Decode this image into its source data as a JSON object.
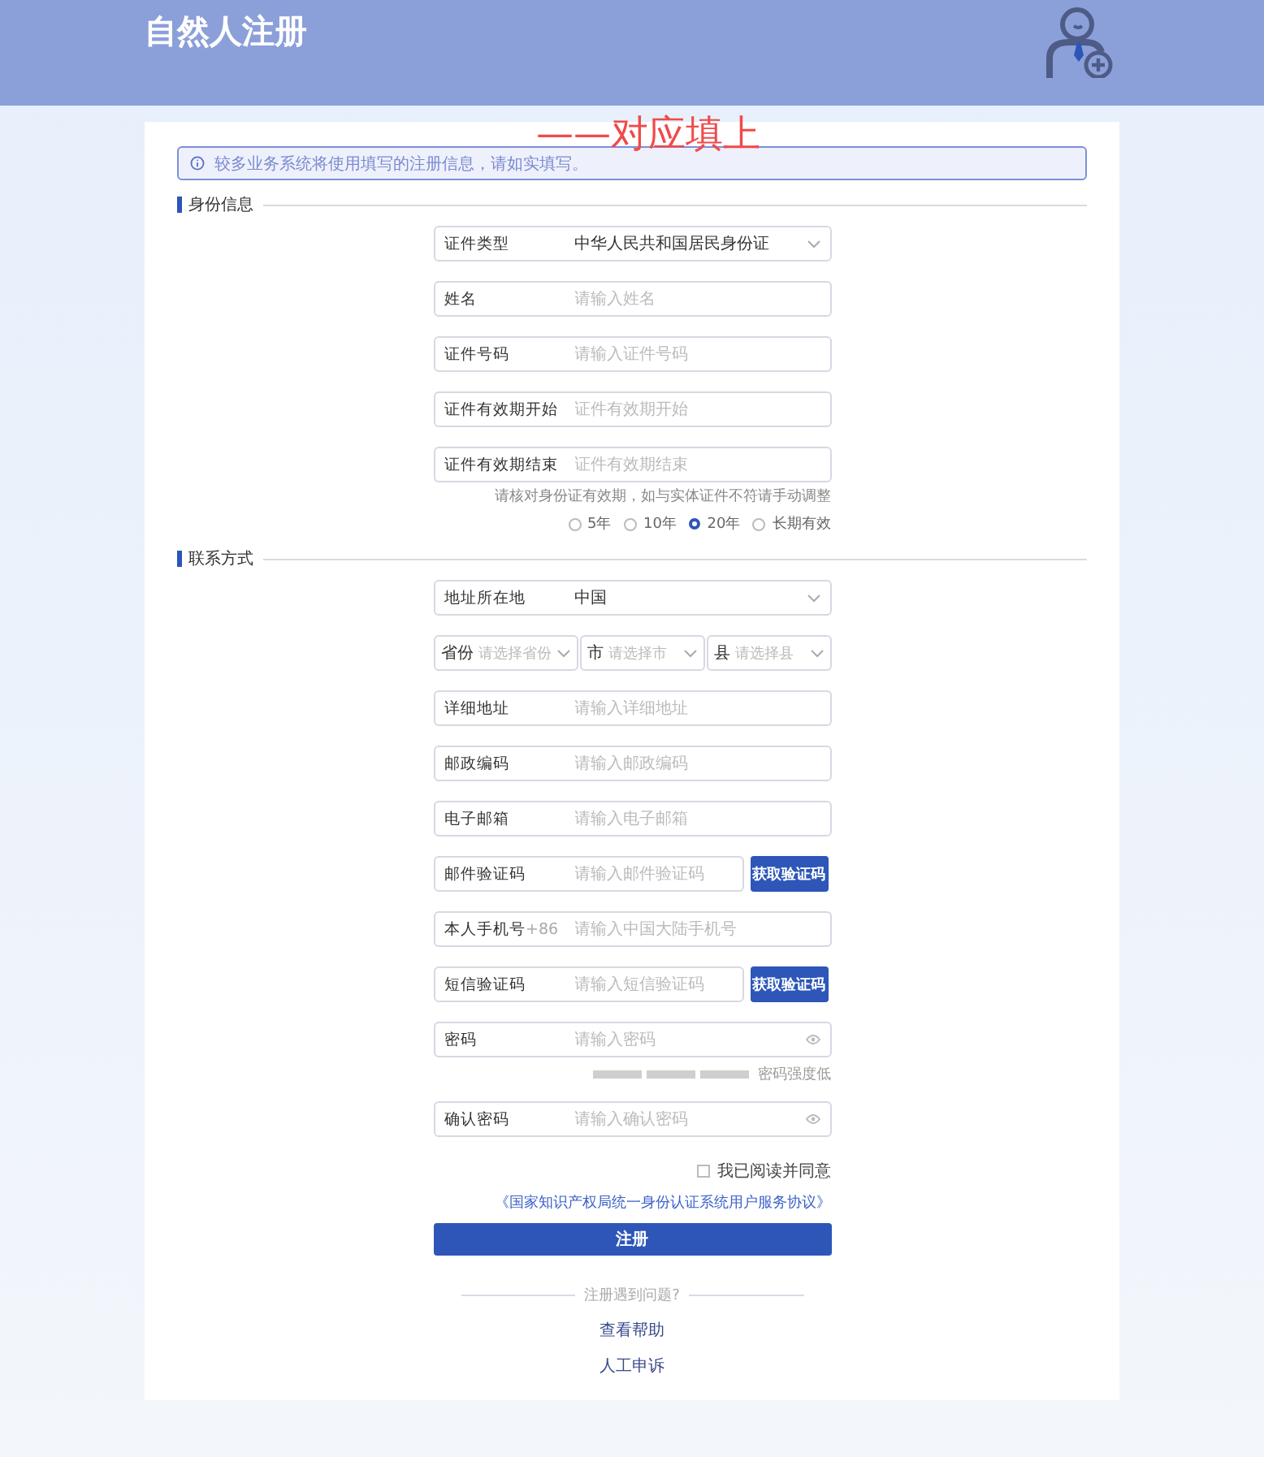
{
  "header": {
    "title": "自然人注册"
  },
  "annotation": "——对应填上",
  "notice": "较多业务系统将使用填写的注册信息，请如实填写。",
  "sections": [
    {
      "title": "身份信息",
      "rows": [
        {
          "kind": "select",
          "label": "证件类型",
          "value": "中华人民共和国居民身份证"
        },
        {
          "kind": "input",
          "label": "姓名",
          "placeholder": "请输入姓名"
        },
        {
          "kind": "input",
          "label": "证件号码",
          "placeholder": "请输入证件号码"
        },
        {
          "kind": "input",
          "label": "证件有效期开始",
          "placeholder": "证件有效期开始"
        },
        {
          "kind": "input",
          "label": "证件有效期结束",
          "placeholder": "证件有效期结束"
        },
        {
          "kind": "radios",
          "note": "请核对身份证有效期，如与实体证件不符请手动调整",
          "options": [
            {
              "label": "5年",
              "selected": false
            },
            {
              "label": "10年",
              "selected": false
            },
            {
              "label": "20年",
              "selected": true
            },
            {
              "label": "长期有效",
              "selected": false
            }
          ]
        }
      ]
    },
    {
      "title": "联系方式",
      "rows": [
        {
          "kind": "select",
          "label": "地址所在地",
          "value": "中国"
        },
        {
          "kind": "triple",
          "parts": [
            {
              "label": "省份",
              "placeholder": "请选择省份"
            },
            {
              "label": "市",
              "placeholder": "请选择市"
            },
            {
              "label": "县",
              "placeholder": "请选择县"
            }
          ]
        },
        {
          "kind": "input",
          "label": "详细地址",
          "placeholder": "请输入详细地址"
        },
        {
          "kind": "input",
          "label": "邮政编码",
          "placeholder": "请输入邮政编码"
        },
        {
          "kind": "input",
          "label": "电子邮箱",
          "placeholder": "请输入电子邮箱"
        },
        {
          "kind": "code",
          "label": "邮件验证码",
          "placeholder": "请输入邮件验证码",
          "button": "获取验证码"
        },
        {
          "kind": "input",
          "label": "本人手机号",
          "prefix": "+86",
          "placeholder": "请输入中国大陆手机号"
        },
        {
          "kind": "code",
          "label": "短信验证码",
          "placeholder": "请输入短信验证码",
          "button": "获取验证码"
        },
        {
          "kind": "password",
          "label": "密码",
          "placeholder": "请输入密码"
        },
        {
          "kind": "strength",
          "label": "密码强度低"
        },
        {
          "kind": "password",
          "label": "确认密码",
          "placeholder": "请输入确认密码"
        }
      ]
    }
  ],
  "agreement": {
    "checked": false,
    "label": "我已阅读并同意",
    "link": "《国家知识产权局统一身份认证系统用户服务协议》"
  },
  "submit": "注册",
  "help": {
    "divider": "注册遇到问题?",
    "links": [
      "查看帮助",
      "人工申诉"
    ]
  }
}
